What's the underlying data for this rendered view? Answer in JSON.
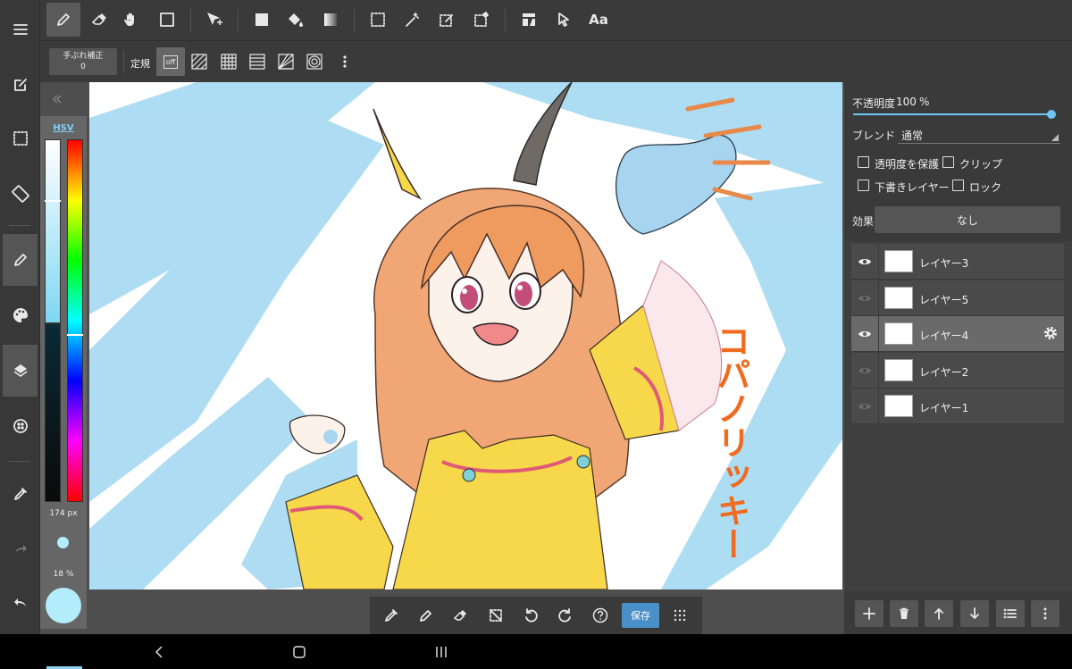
{
  "toolbar": {
    "stabilizer_label": "手ぶれ補正",
    "stabilizer_value": "0",
    "ruler_label": "定規",
    "ruler_off": "off",
    "text_tool": "Aa"
  },
  "color": {
    "mode": "HSV",
    "brush_size": "174 px",
    "opacity": "18 %",
    "current": "#b3ecfa"
  },
  "layer_props": {
    "opacity_label": "不透明度",
    "opacity_value": "100",
    "opacity_unit": "%",
    "opacity_level": 1.0,
    "blend_label": "ブレンド",
    "blend_value": "通常",
    "protect_alpha": "透明度を保護",
    "clip": "クリップ",
    "draft": "下書きレイヤー",
    "lock": "ロック",
    "effect_label": "効果",
    "effect_value": "なし"
  },
  "layers": [
    {
      "name": "レイヤー3",
      "visible": true,
      "selected": false
    },
    {
      "name": "レイヤー5",
      "visible": false,
      "selected": false
    },
    {
      "name": "レイヤー4",
      "visible": true,
      "selected": true
    },
    {
      "name": "レイヤー2",
      "visible": false,
      "selected": false
    },
    {
      "name": "レイヤー1",
      "visible": false,
      "selected": false
    }
  ],
  "bottom": {
    "save_label": "保存"
  },
  "artwork": {
    "text": "コパノリッキー"
  },
  "colors": {
    "accent": "#4aa8d8",
    "save": "#4a90c8",
    "sky": "#8fd0ef",
    "hair": "#e8884a",
    "dress": "#f6d84a"
  }
}
